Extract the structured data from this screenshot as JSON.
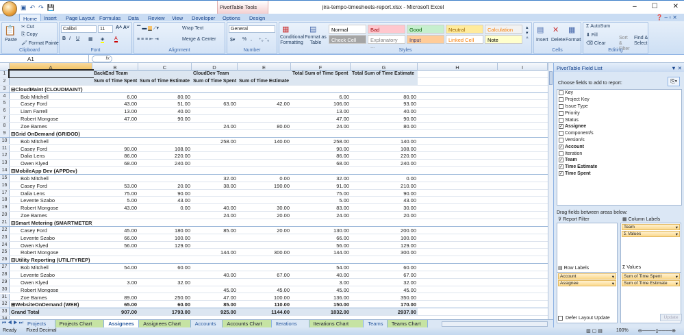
{
  "window": {
    "title": "jira-tempo-timesheets-report.xlsx - Microsoft Excel",
    "context_tab": "PivotTable Tools",
    "min": "–",
    "max": "☐",
    "close": "✕"
  },
  "tabs": [
    "Home",
    "Insert",
    "Page Layout",
    "Formulas",
    "Data",
    "Review",
    "View",
    "Developer",
    "Options",
    "Design"
  ],
  "ribbon": {
    "clipboard": {
      "label": "Clipboard",
      "paste": "Paste",
      "cut": "Cut",
      "copy": "Copy",
      "format_painter": "Format Painter"
    },
    "font": {
      "label": "Font",
      "name": "Calibri",
      "size": "11",
      "bold": "B",
      "italic": "I",
      "underline": "U"
    },
    "alignment": {
      "label": "Alignment",
      "wrap": "Wrap Text",
      "merge": "Merge & Center"
    },
    "number": {
      "label": "Number",
      "format": "General",
      "percent": "%",
      "comma": ","
    },
    "styles": {
      "label": "Styles",
      "conditional": "Conditional Formatting",
      "format_table": "Format as Table",
      "cells": [
        {
          "t": "Normal",
          "bg": "#ffffff",
          "fg": "#000000"
        },
        {
          "t": "Bad",
          "bg": "#ffc7ce",
          "fg": "#9c0006"
        },
        {
          "t": "Good",
          "bg": "#c6efce",
          "fg": "#006100"
        },
        {
          "t": "Neutral",
          "bg": "#ffeb9c",
          "fg": "#9c6500"
        },
        {
          "t": "Calculation",
          "bg": "#f2f2f2",
          "fg": "#fa7d00"
        },
        {
          "t": "Check Cell",
          "bg": "#a5a5a5",
          "fg": "#ffffff"
        },
        {
          "t": "Explanatory ...",
          "bg": "#ffffff",
          "fg": "#7f7f7f"
        },
        {
          "t": "Input",
          "bg": "#ffcc99",
          "fg": "#3f3f76"
        },
        {
          "t": "Linked Cell",
          "bg": "#ffffff",
          "fg": "#fa7d00"
        },
        {
          "t": "Note",
          "bg": "#ffffcc",
          "fg": "#000000"
        }
      ]
    },
    "cells": {
      "label": "Cells",
      "insert": "Insert",
      "delete": "Delete",
      "format": "Format"
    },
    "editing": {
      "label": "Editing",
      "autosum": "AutoSum",
      "fill": "Fill",
      "clear": "Clear",
      "sort": "Sort & Filter",
      "find": "Find & Select"
    }
  },
  "formula_bar": {
    "name_box": "A1",
    "fx": "fx",
    "value": ""
  },
  "columns": [
    "A",
    "B",
    "C",
    "D",
    "E",
    "F",
    "G",
    "H",
    "I"
  ],
  "header_rows": [
    [
      "",
      "BackEnd Team",
      "",
      "CloudDev Team",
      "",
      "Total Sum of Time Spent",
      "Total Sum of Time Estimate"
    ],
    [
      "",
      "Sum of Time Spent",
      "Sum of Time Estimate",
      "Sum of Time Spent",
      "Sum of Time Estimate",
      "",
      ""
    ]
  ],
  "rows": [
    {
      "k": "g",
      "v": [
        "⊟CloudMaint (CLOUDMAINT)",
        "",
        "",
        "",
        "",
        "",
        ""
      ]
    },
    {
      "k": "i",
      "v": [
        "Bob Mitchell",
        "6.00",
        "80.00",
        "",
        "",
        "6.00",
        "80.00"
      ]
    },
    {
      "k": "i",
      "v": [
        "Casey Ford",
        "43.00",
        "51.00",
        "63.00",
        "42.00",
        "106.00",
        "93.00"
      ]
    },
    {
      "k": "i",
      "v": [
        "Liam Farrell",
        "13.00",
        "40.00",
        "",
        "",
        "13.00",
        "40.00"
      ]
    },
    {
      "k": "i",
      "v": [
        "Robert Mongose",
        "47.00",
        "90.00",
        "",
        "",
        "47.00",
        "90.00"
      ]
    },
    {
      "k": "i",
      "v": [
        "Zoe Barnes",
        "",
        "",
        "24.00",
        "80.00",
        "24.00",
        "80.00"
      ]
    },
    {
      "k": "g",
      "v": [
        "⊟Grid OnDemand (GRIDOD)",
        "",
        "",
        "",
        "",
        "",
        ""
      ]
    },
    {
      "k": "i",
      "v": [
        "Bob Mitchell",
        "",
        "",
        "258.00",
        "140.00",
        "258.00",
        "140.00"
      ]
    },
    {
      "k": "i",
      "v": [
        "Casey Ford",
        "90.00",
        "108.00",
        "",
        "",
        "90.00",
        "108.00"
      ]
    },
    {
      "k": "i",
      "v": [
        "Dalia Lens",
        "86.00",
        "220.00",
        "",
        "",
        "86.00",
        "220.00"
      ]
    },
    {
      "k": "i",
      "v": [
        "Owen Klyed",
        "68.00",
        "240.00",
        "",
        "",
        "68.00",
        "240.00"
      ]
    },
    {
      "k": "g",
      "v": [
        "⊟MobileApp Dev (APPDev)",
        "",
        "",
        "",
        "",
        "",
        ""
      ]
    },
    {
      "k": "i",
      "v": [
        "Bob Mitchell",
        "",
        "",
        "32.00",
        "0.00",
        "32.00",
        "0.00"
      ]
    },
    {
      "k": "i",
      "v": [
        "Casey Ford",
        "53.00",
        "20.00",
        "38.00",
        "190.00",
        "91.00",
        "210.00"
      ]
    },
    {
      "k": "i",
      "v": [
        "Dalia Lens",
        "75.00",
        "90.00",
        "",
        "",
        "75.00",
        "90.00"
      ]
    },
    {
      "k": "i",
      "v": [
        "Levente Szabo",
        "5.00",
        "43.00",
        "",
        "",
        "5.00",
        "43.00"
      ]
    },
    {
      "k": "i",
      "v": [
        "Robert Mongose",
        "43.00",
        "0.00",
        "40.00",
        "30.00",
        "83.00",
        "30.00"
      ]
    },
    {
      "k": "i",
      "v": [
        "Zoe Barnes",
        "",
        "",
        "24.00",
        "20.00",
        "24.00",
        "20.00"
      ]
    },
    {
      "k": "g",
      "v": [
        "⊟Smart Metering (SMARTMETER)",
        "",
        "",
        "",
        "",
        "",
        ""
      ]
    },
    {
      "k": "i",
      "v": [
        "Casey Ford",
        "45.00",
        "180.00",
        "85.00",
        "20.00",
        "130.00",
        "200.00"
      ]
    },
    {
      "k": "i",
      "v": [
        "Levente Szabo",
        "66.00",
        "100.00",
        "",
        "",
        "66.00",
        "100.00"
      ]
    },
    {
      "k": "i",
      "v": [
        "Owen Klyed",
        "56.00",
        "129.00",
        "",
        "",
        "56.00",
        "129.00"
      ]
    },
    {
      "k": "i",
      "v": [
        "Robert Mongose",
        "",
        "",
        "144.00",
        "300.00",
        "144.00",
        "300.00"
      ]
    },
    {
      "k": "g",
      "v": [
        "⊟Utility Reporting (UTILITYREP)",
        "",
        "",
        "",
        "",
        "",
        ""
      ]
    },
    {
      "k": "i",
      "v": [
        "Bob Mitchell",
        "54.00",
        "60.00",
        "",
        "",
        "54.00",
        "60.00"
      ]
    },
    {
      "k": "i",
      "v": [
        "Levente Szabo",
        "",
        "",
        "40.00",
        "67.00",
        "40.00",
        "67.00"
      ]
    },
    {
      "k": "i",
      "v": [
        "Owen Klyed",
        "3.00",
        "32.00",
        "",
        "",
        "3.00",
        "32.00"
      ]
    },
    {
      "k": "i",
      "v": [
        "Robert Mongose",
        "",
        "",
        "45.00",
        "45.00",
        "45.00",
        "45.00"
      ]
    },
    {
      "k": "i",
      "v": [
        "Zoe Barnes",
        "89.00",
        "250.00",
        "47.00",
        "100.00",
        "136.00",
        "350.00"
      ]
    },
    {
      "k": "g2",
      "v": [
        "⊞WebsiteOnDemand (WEB)",
        "65.00",
        "60.00",
        "85.00",
        "110.00",
        "150.00",
        "170.00"
      ]
    },
    {
      "k": "t",
      "v": [
        "Grand Total",
        "907.00",
        "1793.00",
        "925.00",
        "1144.00",
        "1832.00",
        "2937.00"
      ]
    }
  ],
  "sheet_tabs": [
    {
      "t": "Projects",
      "c": 0
    },
    {
      "t": "Projects Chart",
      "c": 1
    },
    {
      "t": "Assignees",
      "c": 0,
      "a": 1
    },
    {
      "t": "Assignees Chart",
      "c": 1
    },
    {
      "t": "Accounts",
      "c": 0
    },
    {
      "t": "Accounts Chart",
      "c": 1
    },
    {
      "t": "Iterations",
      "c": 0
    },
    {
      "t": "Iterations Chart",
      "c": 1
    },
    {
      "t": "Teams",
      "c": 0
    },
    {
      "t": "Teams Chart",
      "c": 1
    }
  ],
  "status": {
    "ready": "Ready",
    "mode": "Fixed Decimal",
    "zoom": "100%"
  },
  "pivot_pane": {
    "title": "PivotTable Field List",
    "choose": "Choose fields to add to report:",
    "fields": [
      {
        "n": "Key",
        "c": false
      },
      {
        "n": "Project Key",
        "c": false
      },
      {
        "n": "Issue Type",
        "c": false
      },
      {
        "n": "Priority",
        "c": false
      },
      {
        "n": "Status",
        "c": false
      },
      {
        "n": "Assignee",
        "c": true
      },
      {
        "n": "Component/s",
        "c": false
      },
      {
        "n": "Version/s",
        "c": false
      },
      {
        "n": "Account",
        "c": true
      },
      {
        "n": "Iteration",
        "c": false
      },
      {
        "n": "Team",
        "c": true
      },
      {
        "n": "Time Estimate",
        "c": true
      },
      {
        "n": "Time Spent",
        "c": true
      }
    ],
    "drag": "Drag fields between areas below:",
    "report_filter": "Report Filter",
    "column_labels": "Column Labels",
    "row_labels": "Row Labels",
    "values": "Values",
    "column_items": [
      "Team",
      "Σ Values"
    ],
    "row_items": [
      "Account",
      "Assignee"
    ],
    "value_items": [
      "Sum of Time Spent",
      "Sum of Time Estimate"
    ],
    "defer": "Defer Layout Update",
    "update": "Update"
  }
}
